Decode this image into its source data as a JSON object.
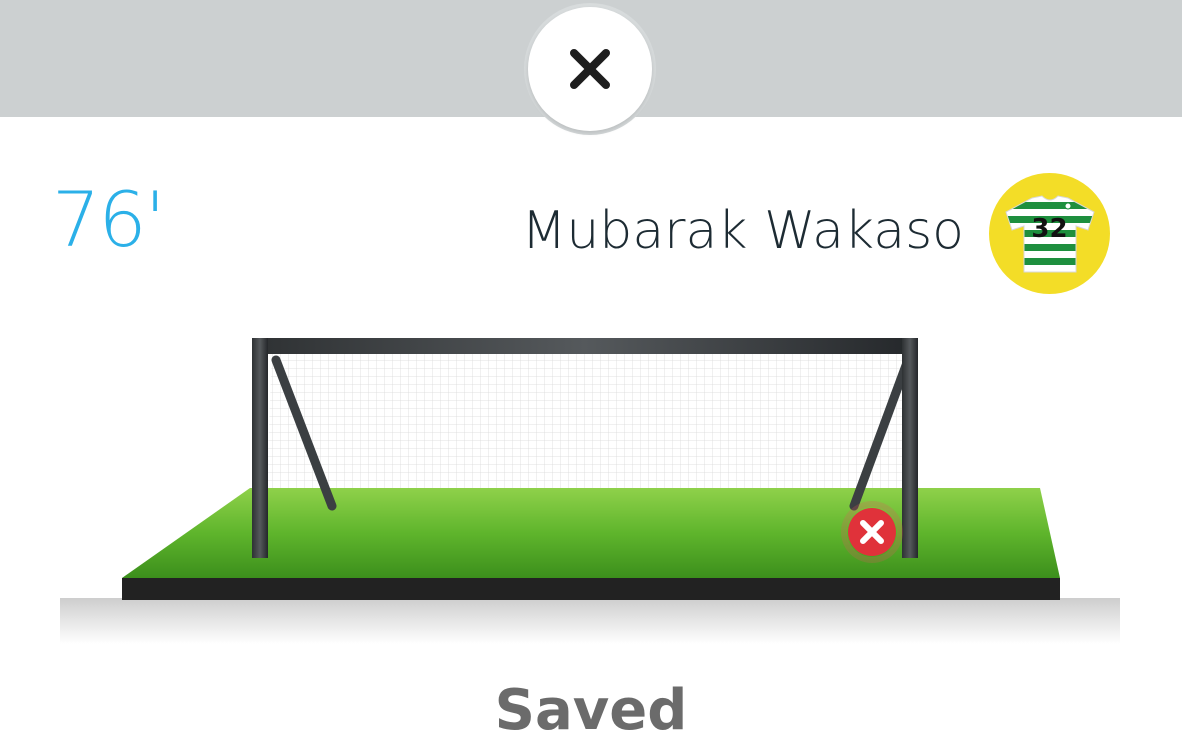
{
  "event": {
    "minute": "76'",
    "player_name": "Mubarak Wakaso",
    "jersey_number": "32",
    "outcome": "Saved"
  },
  "icons": {
    "close": "close-icon",
    "jersey": "jersey-icon",
    "shot_marker": "x-circle-icon",
    "goal": "football-goal-illustration"
  },
  "colors": {
    "minute": "#2bb0e8",
    "player_name": "#1d2b33",
    "outcome": "#6b6b6b",
    "avatar_bg": "#f3dd27",
    "marker": "#e0323a",
    "backdrop": "#ccd0d1",
    "jersey_green": "#1e8f3e"
  }
}
